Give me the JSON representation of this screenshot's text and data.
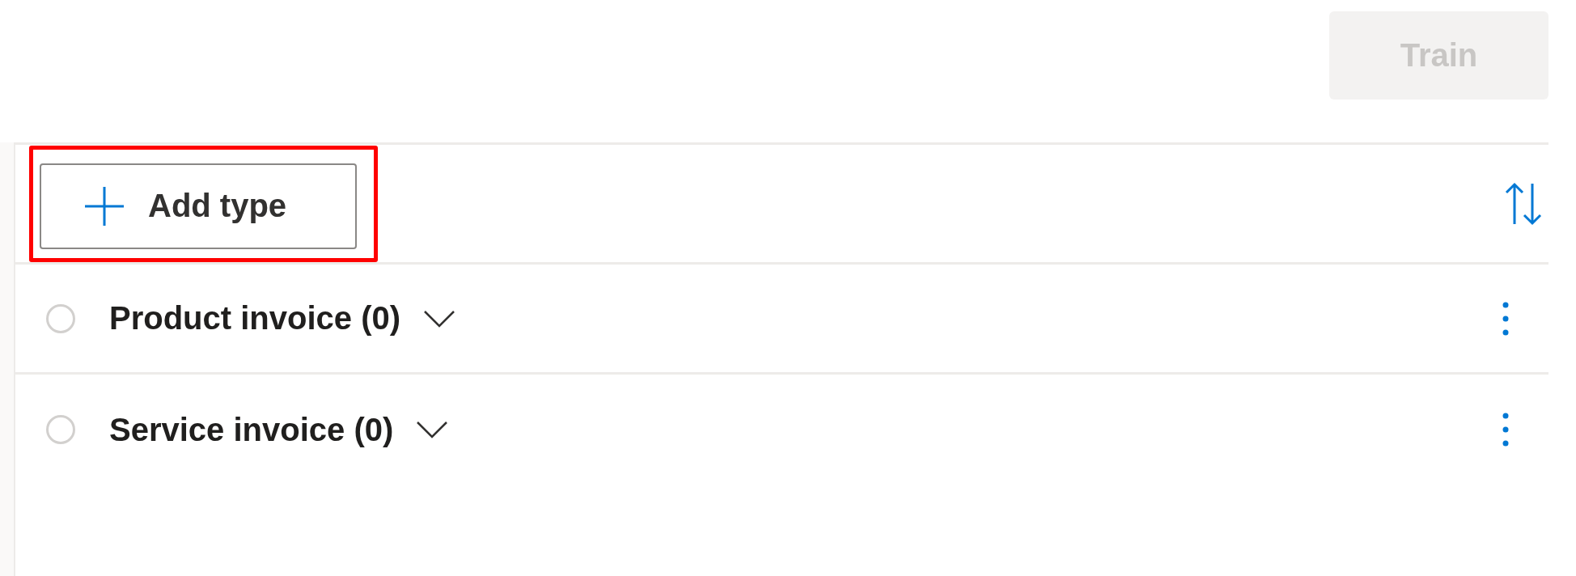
{
  "train_button": {
    "label": "Train",
    "disabled": true
  },
  "add_type_button": {
    "label": "Add type",
    "highlighted": true
  },
  "types": [
    {
      "name": "Product invoice (0)",
      "selected": false,
      "expanded": false
    },
    {
      "name": "Service invoice (0)",
      "selected": false,
      "expanded": false
    }
  ]
}
